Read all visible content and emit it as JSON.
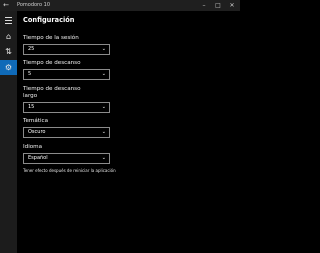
{
  "window": {
    "title": "Pomodoro 10",
    "back_glyph": "←",
    "minimize_glyph": "–",
    "maximize_glyph": "□",
    "close_glyph": "✕"
  },
  "sidebar": {
    "items": [
      {
        "icon": "hamburger-menu-icon"
      },
      {
        "icon": "home-icon",
        "glyph": "⌂"
      },
      {
        "icon": "sort-arrows-icon",
        "glyph": "⇅"
      },
      {
        "icon": "gear-icon",
        "glyph": "⚙",
        "active": true
      }
    ]
  },
  "settings": {
    "title": "Configuración",
    "session_time": {
      "label": "Tiempo de la sesión",
      "value": "25"
    },
    "break_time": {
      "label": "Tiempo de descanso",
      "value": "5"
    },
    "long_break_time": {
      "label_line1": "Tiempo de descanso",
      "label_line2": "largo",
      "value": "15"
    },
    "theme": {
      "label": "Temática",
      "value": "Oscuro"
    },
    "language": {
      "label": "Idioma",
      "value": "Español"
    },
    "note": "Tener efecto después de reiniciar la aplicación",
    "chevron": "⌄"
  },
  "colors": {
    "accent": "#0f6ab8",
    "background": "#000000",
    "sidebar": "#1c1c1c",
    "titlebar": "#1f1f1f"
  }
}
